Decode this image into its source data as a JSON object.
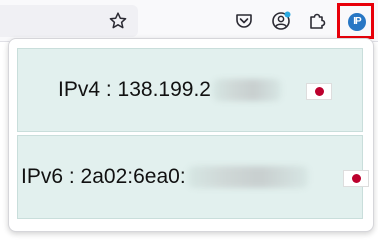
{
  "toolbar": {
    "icons": [
      "bookmark-star-icon",
      "pocket-icon",
      "account-icon",
      "extensions-puzzle-icon"
    ],
    "extension_button": {
      "label": "IP",
      "highlight_color": "#e8000a",
      "badge_color": "#2877c4"
    }
  },
  "popup": {
    "ipv4": {
      "label": "IPv4",
      "separator": " : ",
      "visible_value": "138.199.2",
      "country_flag": "japan-flag"
    },
    "ipv6": {
      "label": "IPv6",
      "separator": " : ",
      "visible_value": "2a02:6ea0:",
      "country_flag": "japan-flag"
    },
    "box_color": "#e2f0ee",
    "flag_sun_color": "#bc002d"
  }
}
